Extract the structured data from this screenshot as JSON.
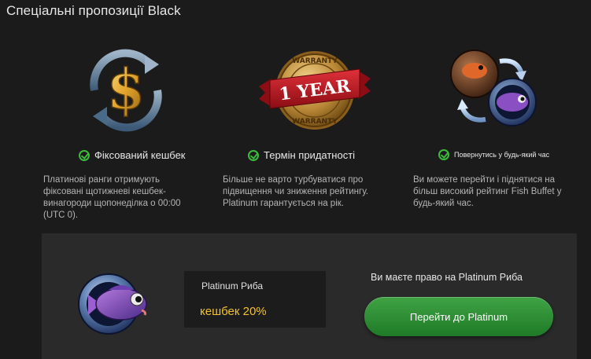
{
  "page": {
    "title": "Спеціальні пропозиції Black"
  },
  "features": [
    {
      "heading": "Фіксований кешбек",
      "description": "Платинові ранги отримують фіксовані щотижневі кешбек-винагороди щопонеділка о 00:00 (UTC 0)."
    },
    {
      "heading": "Термін придатності",
      "badge_text": "1 YEAR",
      "seal_text_top": "WARRANTY",
      "seal_text_bottom": "WARRANTY",
      "description": "Більше не варто турбуватися про підвищення чи зниження рейтингу. Platinum гарантується на рік."
    },
    {
      "heading": "Повернутись у будь-який час",
      "description": "Ви можете перейти і піднятися на більш високий рейтинг Fish Buffet у будь-який час."
    }
  ],
  "panel": {
    "rank_title": "Platinum Риба",
    "cashback": "кешбек 20%",
    "eligible_text": "Ви маєте право на Platinum Риба",
    "cta_label": "Перейти до Platinum"
  },
  "colors": {
    "background": "#1b1b1b",
    "panel": "#2a2a2a",
    "accent_green": "#3dbb3d",
    "cashback_gold": "#f2c12e"
  }
}
